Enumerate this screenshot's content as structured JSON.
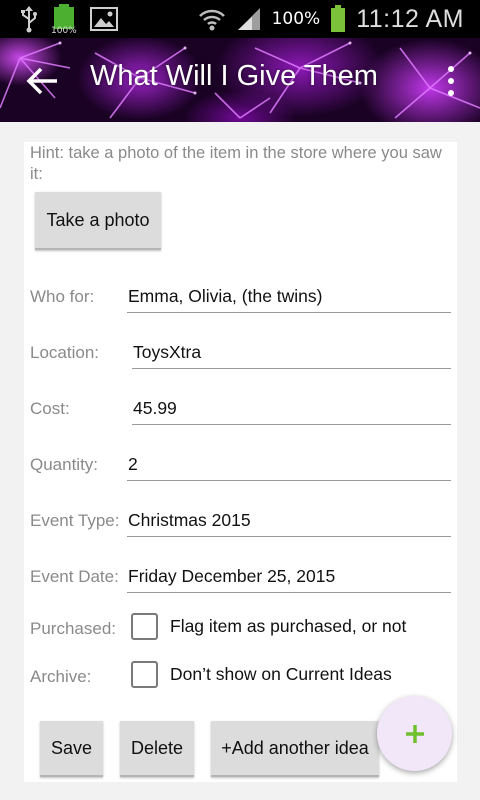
{
  "status_bar": {
    "battery_small_label": "100%",
    "battery_percent": "100%",
    "time": "11:12 AM"
  },
  "app_bar": {
    "title": "What Will I Give Them"
  },
  "hint": "Hint: take a photo of the item in the store where you saw it:",
  "photo_button": "Take a photo",
  "fields": {
    "who_for": {
      "label": "Who for:",
      "value": "Emma, Olivia, (the twins)"
    },
    "location": {
      "label": "Location:",
      "value": "ToysXtra"
    },
    "cost": {
      "label": "Cost:",
      "value": "45.99"
    },
    "quantity": {
      "label": "Quantity:",
      "value": "2"
    },
    "event_type": {
      "label": "Event Type:",
      "value": "Christmas 2015"
    },
    "event_date": {
      "label": "Event Date:",
      "value": "Friday December 25, 2015"
    }
  },
  "purchased": {
    "label": "Purchased:",
    "checkbox_label": "Flag item as purchased, or not",
    "checked": false
  },
  "archive": {
    "label": "Archive:",
    "checkbox_label": "Don’t show on Current Ideas",
    "checked": false
  },
  "buttons": {
    "save": "Save",
    "delete": "Delete",
    "add_another": "+Add another idea"
  },
  "fab": {
    "icon": "plus-icon",
    "color": "#6fbf2e"
  },
  "colors": {
    "fab_background": "#f1e7f8",
    "accent": "#b028e0"
  }
}
